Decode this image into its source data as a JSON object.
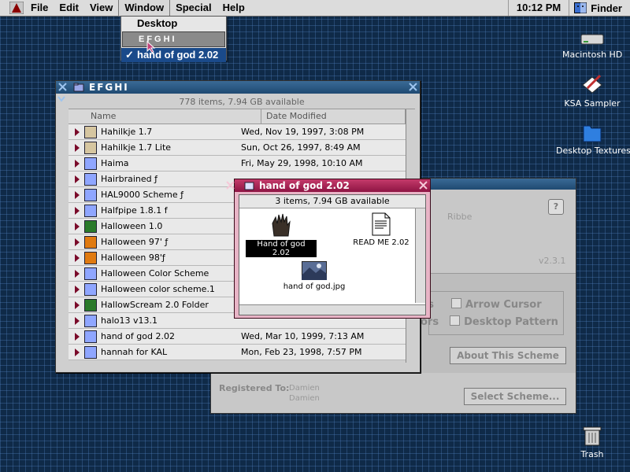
{
  "menubar": {
    "items": [
      "File",
      "Edit",
      "View",
      "Window",
      "Special",
      "Help"
    ],
    "clock": "10:12 PM",
    "app": "Finder"
  },
  "window_menu": {
    "items": [
      "Desktop",
      "EFGHI",
      "hand of god 2.02"
    ],
    "checkmark": "✓"
  },
  "efghi_window": {
    "title": "EFGHI",
    "info": "778 items, 7.94 GB available",
    "columns": [
      "Name",
      "Date Modified"
    ],
    "rows": [
      {
        "name": "Hahilkje 1.7",
        "date": "Wed, Nov 19, 1997, 3:08 PM",
        "icon": "app-icon"
      },
      {
        "name": "Hahilkje 1.7 Lite",
        "date": "Sun, Oct 26, 1997, 8:49 AM",
        "icon": "app-icon"
      },
      {
        "name": "Haima",
        "date": "Fri, May 29, 1998, 10:10 AM",
        "icon": "scheme-icon"
      },
      {
        "name": "Hairbrained ƒ",
        "date": "",
        "icon": "scheme-icon"
      },
      {
        "name": "HAL9000 Scheme ƒ",
        "date": "",
        "icon": "scheme-icon"
      },
      {
        "name": "Halfpipe 1.8.1 f",
        "date": "",
        "icon": "scheme-icon"
      },
      {
        "name": "Halloween 1.0",
        "date": "",
        "icon": "halloween-icon"
      },
      {
        "name": "Halloween 97' ƒ",
        "date": "",
        "icon": "pumpkin-icon"
      },
      {
        "name": "Halloween 98'ƒ",
        "date": "",
        "icon": "pumpkin-icon"
      },
      {
        "name": "Halloween Color Scheme",
        "date": "",
        "icon": "scheme-icon"
      },
      {
        "name": "Halloween color scheme.1",
        "date": "",
        "icon": "scheme-icon"
      },
      {
        "name": "HallowScream 2.0 Folder",
        "date": "",
        "icon": "halloween-icon"
      },
      {
        "name": "halo13 v13.1",
        "date": "",
        "icon": "scheme-icon"
      },
      {
        "name": "hand of god 2.02",
        "date": "Wed, Mar 10, 1999, 7:13 AM",
        "icon": "scheme-icon"
      },
      {
        "name": "hannah for KAL",
        "date": "Mon, Feb 23, 1998, 7:57 PM",
        "icon": "scheme-icon"
      }
    ]
  },
  "hog_window": {
    "title": "hand of god 2.02",
    "info": "3 items, 7.94 GB available",
    "items": [
      "Hand of god 2.02",
      "READ ME 2.02",
      "hand of god.jpg"
    ]
  },
  "appearance_panel": {
    "author_fragment": "Ribbe",
    "version": "v2.3.1",
    "help": "?",
    "checkbox_prefix_1": "ns",
    "checkbox_prefix_2": "ors",
    "arrow_cursor": "Arrow Cursor",
    "desktop_pattern": "Desktop Pattern",
    "about_button": "About This Scheme",
    "registered_label": "Registered To:",
    "registered_name1": "Damien",
    "registered_name2": "Damien",
    "select_button": "Select Scheme..."
  },
  "desktop": {
    "icons": [
      "Macintosh HD",
      "KSA Sampler",
      "Desktop Textures",
      "Trash"
    ]
  },
  "colors": {
    "desktop": "#0f2a48",
    "titlebar": "#1f4a72",
    "pink_titlebar": "#8e1443",
    "triangle": "#7a0b2a"
  }
}
